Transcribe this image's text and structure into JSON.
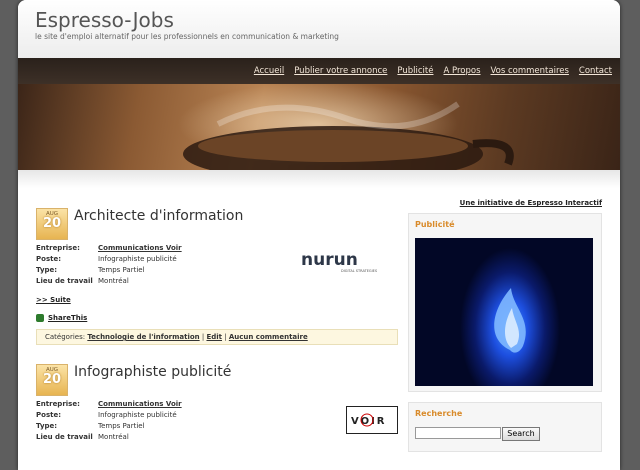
{
  "header": {
    "site_title": "Espresso-Jobs",
    "tagline": "le site d'emploi alternatif pour les professionnels en communication & marketing"
  },
  "nav": {
    "items": [
      "Accueil",
      "Publier votre annonce",
      "Publicité",
      "A Propos",
      "Vos commentaires",
      "Contact"
    ]
  },
  "initiative": "Une initiative de Espresso Interactif",
  "posts": [
    {
      "date_month": "AUG",
      "date_day": "20",
      "title": "Architecte d'information",
      "fields": [
        {
          "label": "Entreprise:",
          "value": "Communications Voir"
        },
        {
          "label": "Poste:",
          "value": "Infographiste publicité"
        },
        {
          "label": "Type:",
          "value": "Temps Partiel"
        },
        {
          "label": "Lieu de travail",
          "value": "Montréal"
        }
      ],
      "more": ">> Suite",
      "share": "ShareThis",
      "categories_label": "Catégories:",
      "category": "Technologie de l'information",
      "edit": "Edit",
      "comments": "Aucun commentaire",
      "logo_text": "nurun",
      "logo_subtext": "DIGITAL STRATEGIES"
    },
    {
      "date_month": "AUG",
      "date_day": "20",
      "title": "Infographiste publicité",
      "fields": [
        {
          "label": "Entreprise:",
          "value": "Communications Voir"
        },
        {
          "label": "Poste:",
          "value": "Infographiste publicité"
        },
        {
          "label": "Type:",
          "value": "Temps Partiel"
        },
        {
          "label": "Lieu de travail",
          "value": "Montréal"
        }
      ],
      "logo_text": "VOIR"
    }
  ],
  "sidebar": {
    "ad_title": "Publicité",
    "search_title": "Recherche",
    "search_button": "Search"
  }
}
